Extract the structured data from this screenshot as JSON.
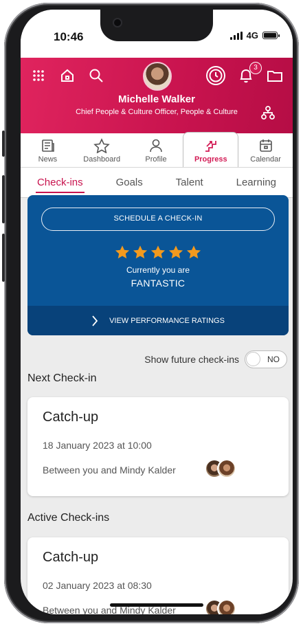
{
  "status_bar": {
    "time": "10:46",
    "network": "4G"
  },
  "header": {
    "user_name": "Michelle Walker",
    "user_role": "Chief People & Culture Officer, People & Culture",
    "notification_count": "3",
    "accent_color": "#c8134e"
  },
  "nav_tabs": [
    {
      "label": "News",
      "icon": "news-icon"
    },
    {
      "label": "Dashboard",
      "icon": "star-icon"
    },
    {
      "label": "Profile",
      "icon": "person-icon"
    },
    {
      "label": "Progress",
      "icon": "stairs-icon",
      "active": true
    },
    {
      "label": "Calendar",
      "icon": "calendar-icon"
    }
  ],
  "sub_tabs": [
    {
      "label": "Check-ins",
      "active": true
    },
    {
      "label": "Goals"
    },
    {
      "label": "Talent"
    },
    {
      "label": "Learning"
    }
  ],
  "rating_card": {
    "schedule_label": "SCHEDULE A CHECK-IN",
    "stars": 5,
    "status_prefix": "Currently you are",
    "status_value": "FANTASTIC",
    "view_ratings_label": "VIEW PERFORMANCE RATINGS",
    "card_color": "#0a5597",
    "star_color": "#f39a1e"
  },
  "future_toggle": {
    "label": "Show future check-ins",
    "value": "NO"
  },
  "next_checkin": {
    "heading": "Next Check-in",
    "title": "Catch-up",
    "date": "18 January 2023 at 10:00",
    "between": "Between you and Mindy Kalder"
  },
  "active_checkins": {
    "heading": "Active Check-ins",
    "title": "Catch-up",
    "date": "02 January 2023 at 08:30",
    "between": "Between you and Mindy Kalder"
  }
}
